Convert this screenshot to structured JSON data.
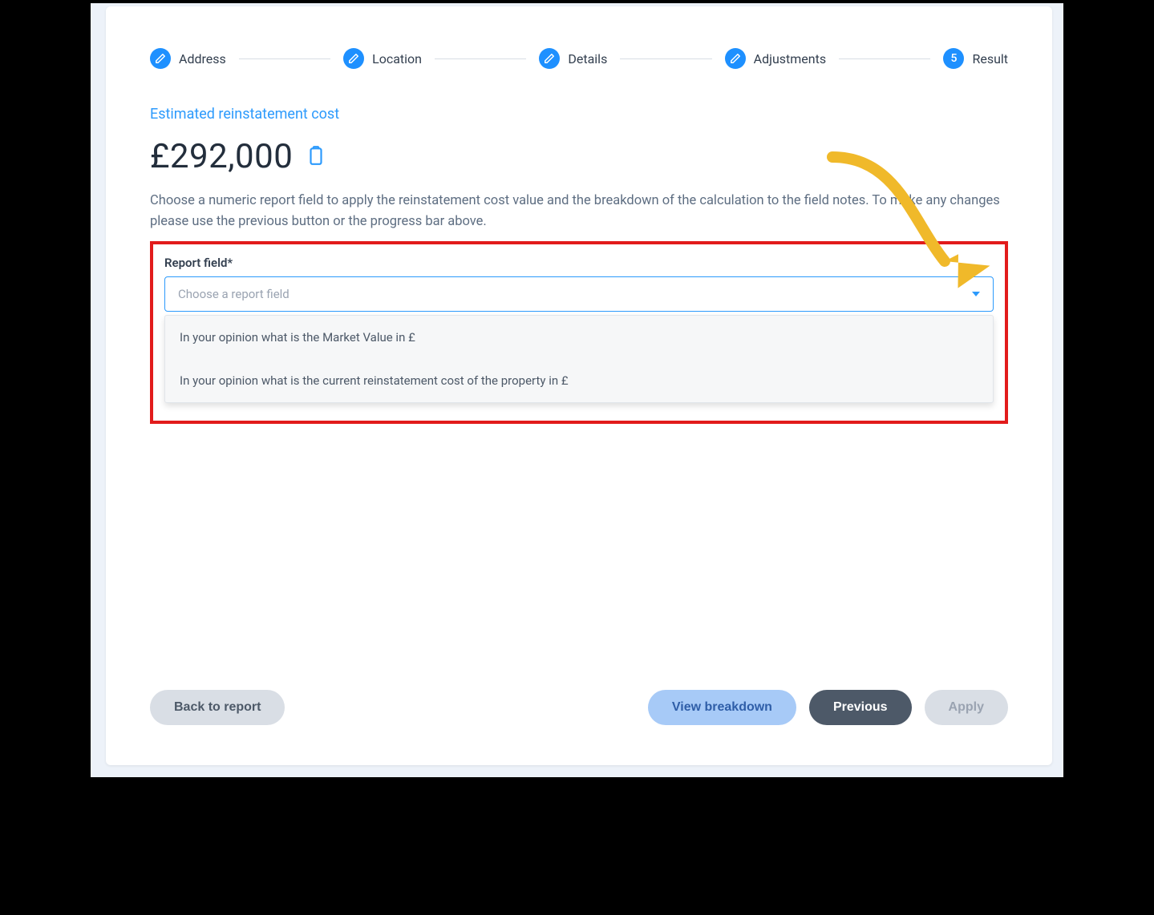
{
  "steps": [
    {
      "label": "Address",
      "icon": "pencil"
    },
    {
      "label": "Location",
      "icon": "pencil"
    },
    {
      "label": "Details",
      "icon": "pencil"
    },
    {
      "label": "Adjustments",
      "icon": "pencil"
    },
    {
      "label": "Result",
      "number": "5"
    }
  ],
  "title": "Estimated reinstatement cost",
  "cost_value": "£292,000",
  "description": "Choose a numeric report field to apply the reinstatement cost value and the breakdown of the calculation to the field notes. To make any changes please use the previous button or the progress bar above.",
  "field": {
    "label": "Report field*",
    "placeholder": "Choose a report field",
    "options": [
      "In your opinion what is the Market Value in £",
      "In your opinion what is the current reinstatement cost of the property in £"
    ]
  },
  "buttons": {
    "back": "Back to report",
    "view": "View breakdown",
    "previous": "Previous",
    "apply": "Apply"
  }
}
